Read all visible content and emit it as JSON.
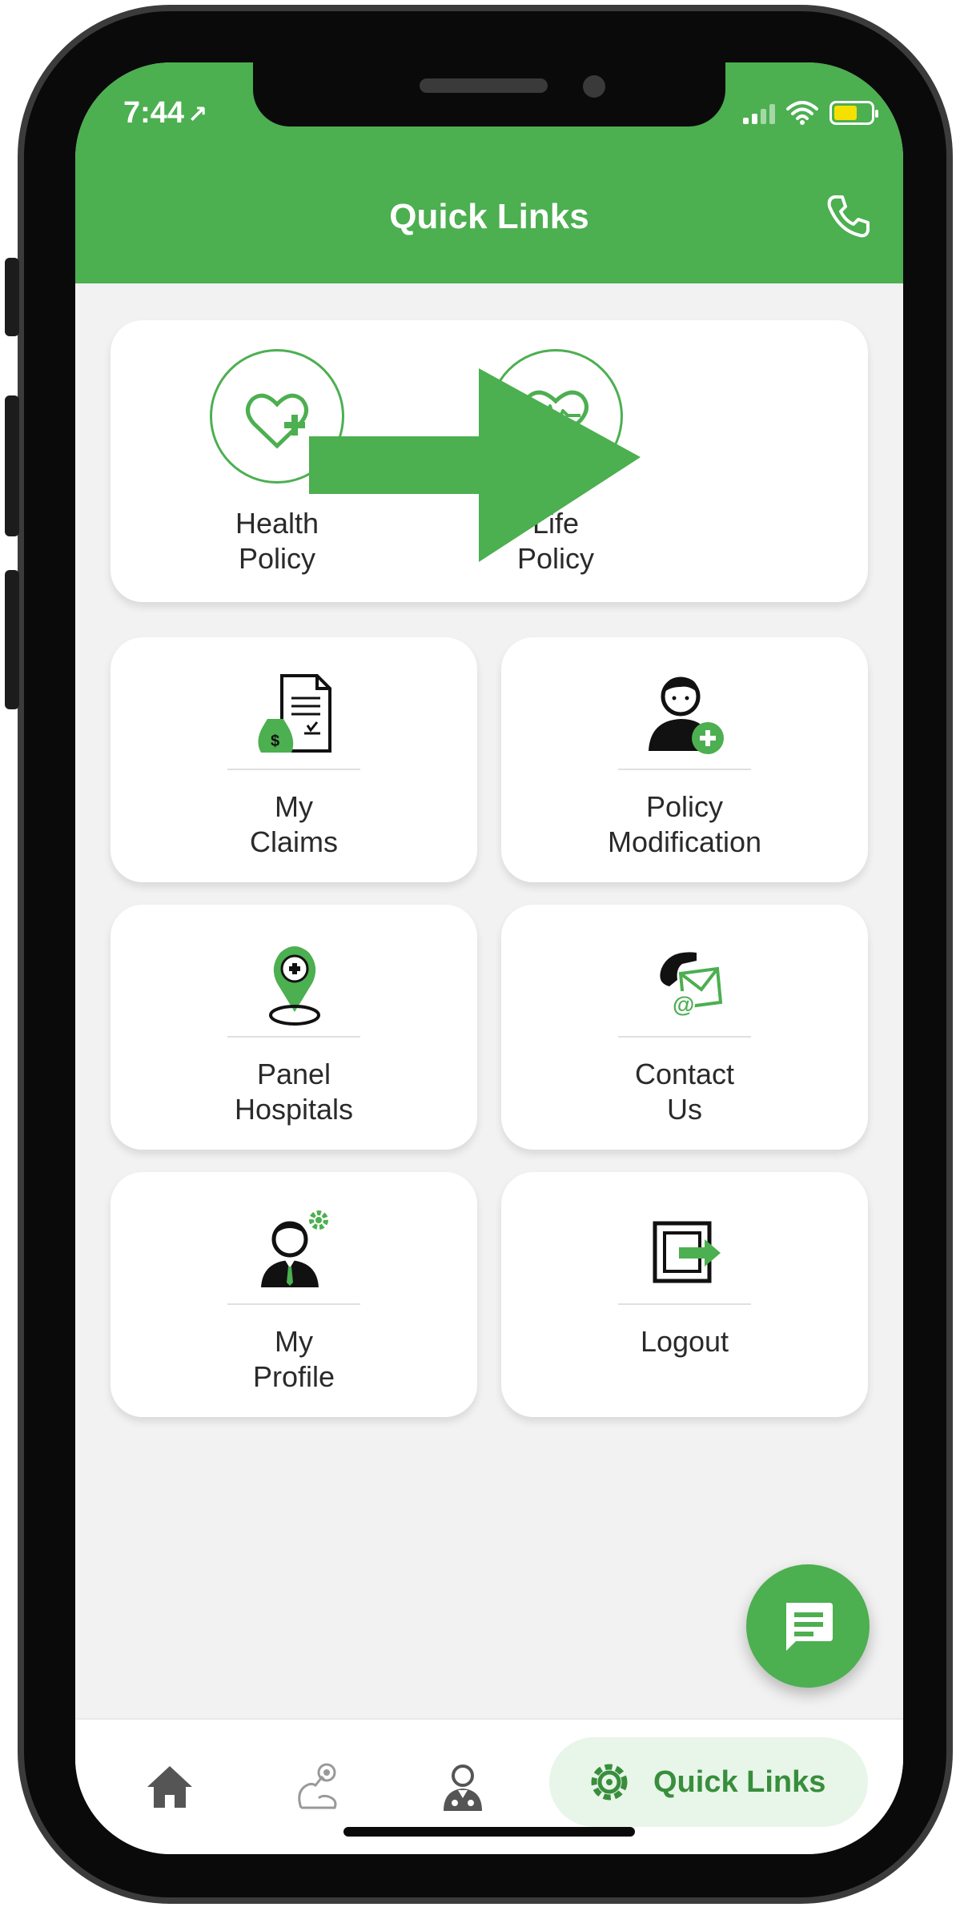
{
  "status_bar": {
    "time": "7:44",
    "location_glyph": "↗"
  },
  "header": {
    "title": "Quick Links",
    "action_icon": "phone-icon"
  },
  "policy_card": {
    "items": [
      {
        "label": "Health\nPolicy",
        "icon": "heart-plus-icon"
      },
      {
        "label": "Life\nPolicy",
        "icon": "heart-pulse-icon"
      }
    ]
  },
  "tiles": [
    {
      "label": "My\nClaims",
      "icon": "claims-document-icon"
    },
    {
      "label": "Policy\nModification",
      "icon": "user-add-icon"
    },
    {
      "label": "Panel\nHospitals",
      "icon": "location-pin-plus-icon"
    },
    {
      "label": "Contact\nUs",
      "icon": "phone-mail-icon"
    },
    {
      "label": "My\nProfile",
      "icon": "profile-settings-icon"
    },
    {
      "label": "Logout",
      "icon": "logout-icon"
    }
  ],
  "fab": {
    "icon": "chat-icon"
  },
  "bottom_nav": {
    "items": [
      {
        "icon": "home-icon"
      },
      {
        "icon": "fitness-icon"
      },
      {
        "icon": "doctor-icon"
      }
    ],
    "active": {
      "label": "Quick Links",
      "icon": "gear-icon"
    }
  },
  "colors": {
    "primary": "#4caf50",
    "primary_dark": "#388e3c",
    "background": "#f2f2f2",
    "card": "#ffffff"
  }
}
